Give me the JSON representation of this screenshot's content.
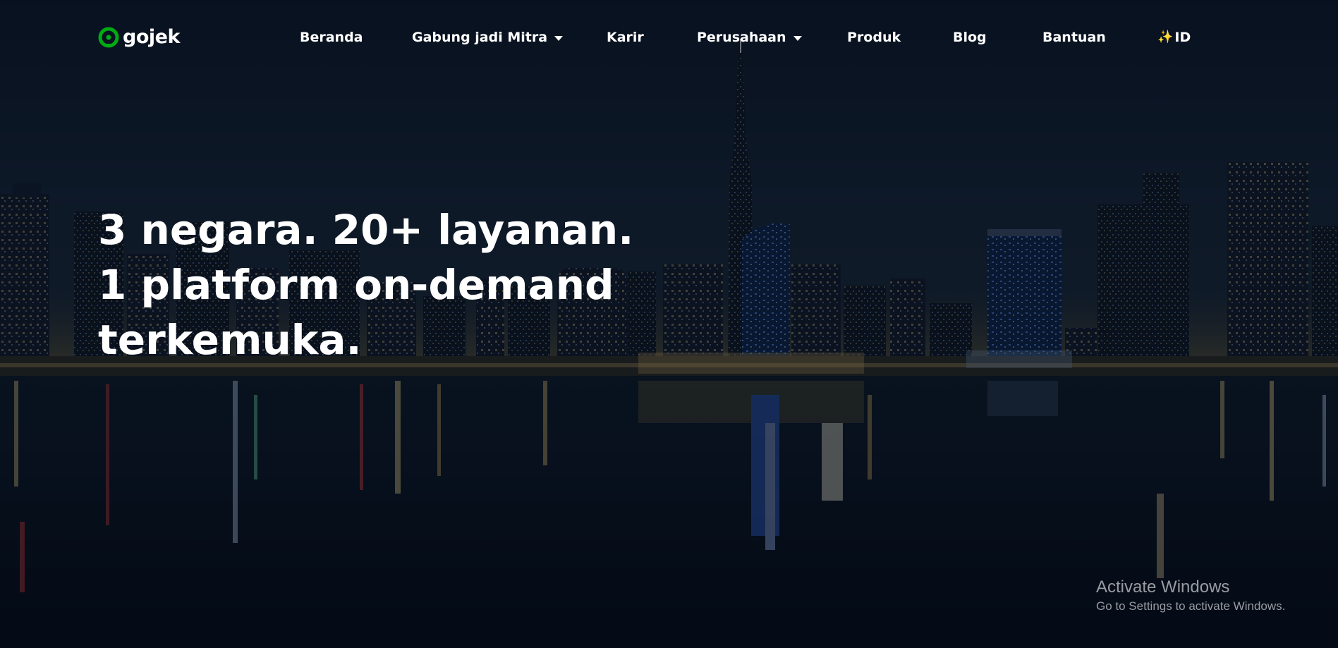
{
  "brand": {
    "logo_text": "gojek",
    "logo_color": "#00AA13"
  },
  "nav": {
    "items": [
      {
        "label": "Beranda",
        "has_dropdown": false
      },
      {
        "label": "Gabung jadi Mitra",
        "has_dropdown": true
      },
      {
        "label": "Karir",
        "has_dropdown": false
      },
      {
        "label": "Perusahaan",
        "has_dropdown": true
      },
      {
        "label": "Produk",
        "has_dropdown": false
      },
      {
        "label": "Blog",
        "has_dropdown": false
      },
      {
        "label": "Bantuan",
        "has_dropdown": false
      }
    ],
    "language": {
      "icon": "sparkle-icon",
      "label": "ID"
    }
  },
  "hero": {
    "headline": "3 negara. 20+ layanan. 1 platform on-demand terkemuka.",
    "background": "night city skyline reflected on water"
  },
  "watermark": {
    "title": "Activate Windows",
    "subtitle": "Go to Settings to activate Windows."
  },
  "colors": {
    "overlay": "#0a1628",
    "text": "#ffffff"
  }
}
